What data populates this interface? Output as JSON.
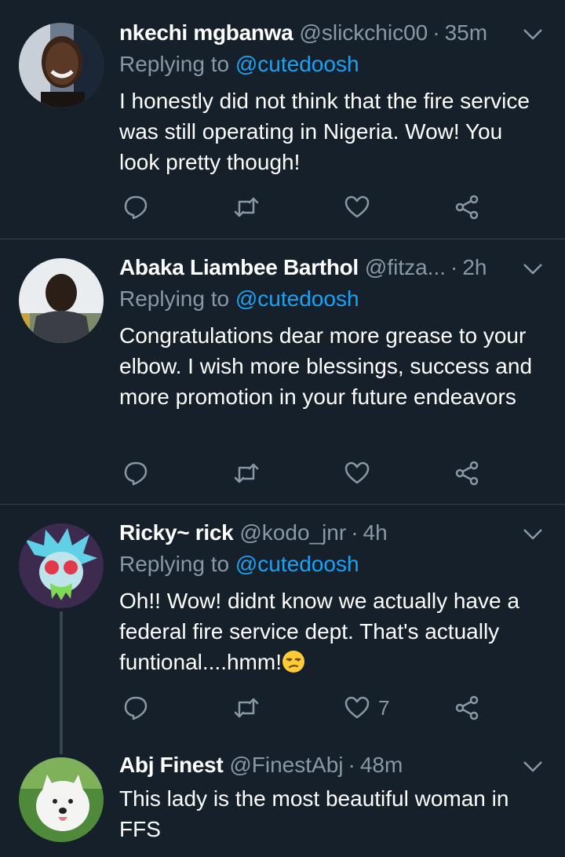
{
  "tweets": [
    {
      "name": "nkechi mgbanwa",
      "handle": "@slickchic00",
      "time": "35m",
      "replying_prefix": "Replying to",
      "replying_to": "@cutedoosh",
      "text": "I honestly did not think that the fire service was still operating in Nigeria. Wow! You look pretty though!"
    },
    {
      "name": "Abaka Liambee Barthol",
      "handle": "@fitza...",
      "time": "2h",
      "replying_prefix": "Replying to",
      "replying_to": "@cutedoosh",
      "text": "Congratulations dear more grease to your elbow. I wish more blessings, success and more promotion in your future endeavors"
    },
    {
      "name": "Ricky~ rick",
      "handle": "@kodo_jnr",
      "time": "4h",
      "replying_prefix": "Replying to",
      "replying_to": "@cutedoosh",
      "text": "Oh!! Wow! didnt know we actually have a federal fire service dept. That's actually funtional....hmm!",
      "emoji": "unamused-face",
      "like_count": "7"
    },
    {
      "name": "Abj Finest",
      "handle": "@FinestAbj",
      "time": "48m",
      "text": "This lady is the most beautiful woman in FFS"
    }
  ],
  "separator": "·",
  "icons": {
    "reply": "reply-icon",
    "retweet": "retweet-icon",
    "like": "heart-icon",
    "share": "share-icon",
    "menu": "chevron-down-icon"
  },
  "colors": {
    "background": "#15202b",
    "text": "#ffffff",
    "secondary": "#8899a6",
    "link": "#1da1f2",
    "divider": "#38444d"
  }
}
